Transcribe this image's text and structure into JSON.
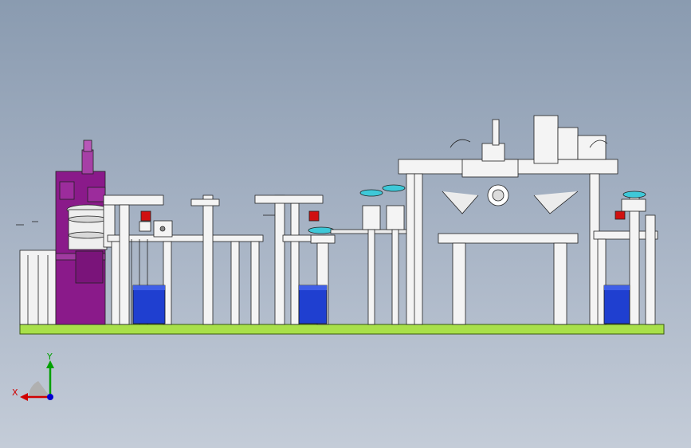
{
  "viewport": {
    "background_top": "#8a9bb0",
    "background_bottom": "#c4ccd8"
  },
  "model": {
    "base_color": "#a8e04a",
    "frame_color": "#f2f2f2",
    "outline_color": "#222222",
    "machine_body_color": "#8a1a8a",
    "bin_color": "#1f3fd0",
    "red_part_color": "#d01010",
    "cyan_part_color": "#3ec8d8"
  },
  "triad": {
    "x_label": "X",
    "y_label": "Y",
    "x_color": "#d00000",
    "y_color": "#00a000",
    "z_color": "#0000d0"
  }
}
